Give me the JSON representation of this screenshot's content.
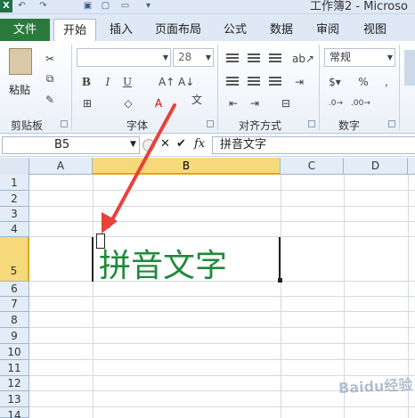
{
  "title_bar": {
    "doc_title": "工作簿2 - Microso",
    "app_icon": "excel-icon"
  },
  "tabs": {
    "file": "文件",
    "items": [
      {
        "label": "开始"
      },
      {
        "label": "插入"
      },
      {
        "label": "页面布局"
      },
      {
        "label": "公式"
      },
      {
        "label": "数据"
      },
      {
        "label": "审阅"
      },
      {
        "label": "视图"
      }
    ]
  },
  "ribbon": {
    "clipboard": {
      "group_label": "剪贴板",
      "paste_label": "粘贴"
    },
    "font": {
      "group_label": "字体",
      "size_value": "28",
      "font_value": "",
      "bold": "B",
      "italic": "I",
      "underline": "U"
    },
    "alignment": {
      "group_label": "对齐方式"
    },
    "number": {
      "group_label": "数字",
      "format_value": "常规"
    }
  },
  "formula_bar": {
    "name_box": "B5",
    "fx": "fx",
    "cancel": "✕",
    "enter": "✔",
    "content": "拼音文字"
  },
  "columns": [
    "A",
    "B",
    "C",
    "D"
  ],
  "rows": [
    "1",
    "2",
    "3",
    "4",
    "5",
    "6",
    "7",
    "8",
    "9",
    "10",
    "11",
    "12",
    "13",
    "14"
  ],
  "cell_b5": "拼音文字",
  "watermark": "Baidu经验",
  "colors": {
    "accent_green": "#1f8a3a",
    "selection": "#f5d97a",
    "arrow": "#e8413a"
  }
}
